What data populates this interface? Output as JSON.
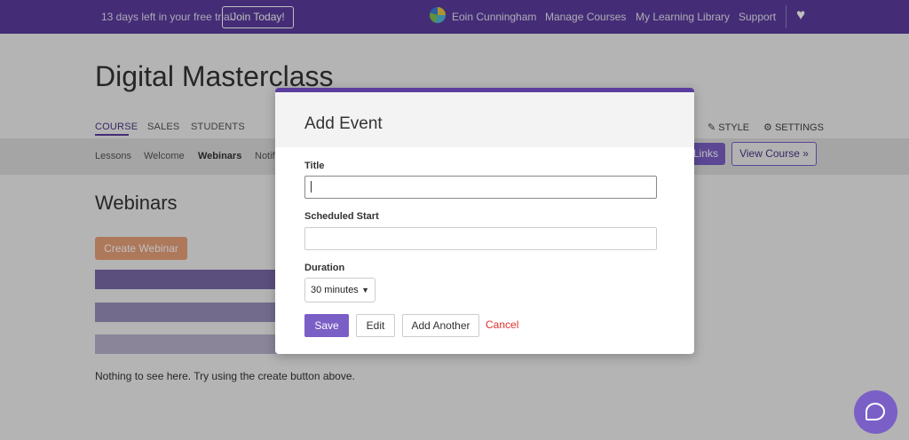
{
  "topbar": {
    "trial_text": "13 days left in your free trial.",
    "join_label": "Join Today!",
    "user_name": "Eoin Cunningham",
    "manage_courses": "Manage Courses",
    "learning_library": "My Learning Library",
    "support": "Support",
    "heart_icon": "heart-icon"
  },
  "page": {
    "title": "Digital Masterclass",
    "tabs": [
      "COURSE",
      "SALES",
      "STUDENTS"
    ],
    "right_tabs": [
      "STYLE",
      "SETTINGS"
    ],
    "subnav": [
      "Lessons",
      "Welcome",
      "Webinars",
      "Notif"
    ],
    "links_label": "Links",
    "view_course_label": "View Course »",
    "section_title": "Webinars",
    "create_label": "Create Webinar",
    "empty_text": "Nothing to see here. Try using the create button above."
  },
  "modal": {
    "title": "Add Event",
    "title_label": "Title",
    "title_value": "",
    "start_label": "Scheduled Start",
    "start_value": "",
    "duration_label": "Duration",
    "duration_value": "30 minutes",
    "save_label": "Save",
    "edit_label": "Edit",
    "add_another_label": "Add Another",
    "cancel_label": "Cancel"
  },
  "colors": {
    "brand": "#5b3d9e",
    "button": "#7a5fc6",
    "cancel": "#e0302c",
    "create": "#e8a07a"
  }
}
